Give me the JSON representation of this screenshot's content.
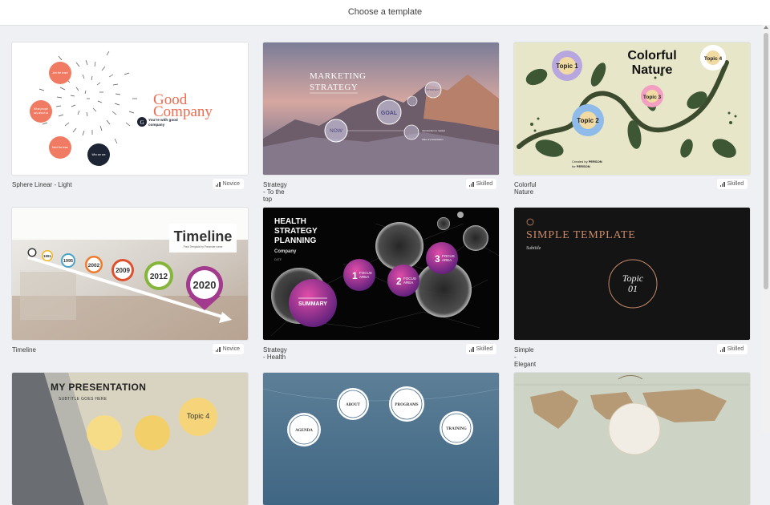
{
  "header": {
    "title": "Choose a template"
  },
  "templates": [
    {
      "name": "Sphere Linear - Light",
      "level": "Novice",
      "text": {
        "title1": "Good",
        "title2": "Company",
        "sub1": "You're with good",
        "sub2": "company",
        "logo": "G",
        "c1": "Join the team!",
        "c2a": "What people",
        "c2b": "say about us",
        "c3": "Meet the team",
        "c4": "Who we are"
      }
    },
    {
      "name": "Strategy - To the top",
      "level": "Skilled",
      "text": {
        "title1": "MARKETING",
        "title2": "STRATEGY",
        "goal": "GOAL",
        "now": "NOW",
        "strategy": "STRATEGY",
        "lbl1": "Introduction to market",
        "lbl2": "Sale of presentation"
      }
    },
    {
      "name": "Colorful Nature",
      "level": "Skilled",
      "text": {
        "title1": "Colorful",
        "title2": "Nature",
        "t1": "Topic 1",
        "t2": "Topic 2",
        "t3": "Topic 3",
        "t4": "Topic 4",
        "credit_prefix": "Created by ",
        "credit_bold": "PERSON",
        "credit2_prefix": "for ",
        "credit2_bold": "PERSON"
      }
    },
    {
      "name": "Timeline",
      "level": "Novice",
      "text": {
        "title": "Timeline",
        "sub": "Prezi Template by Presenter name",
        "years": [
          "1991",
          "1995",
          "2002",
          "2009",
          "2012",
          "2020"
        ]
      }
    },
    {
      "name": "Strategy - Health",
      "level": "Skilled",
      "text": {
        "title1": "HEALTH",
        "title2": "STRATEGY",
        "title3": "PLANNING",
        "company": "Company",
        "date": "DATE",
        "summary": "SUMMARY",
        "n1": "1",
        "n2": "2",
        "n3": "3",
        "focus": "FOCUS",
        "area": "AREA"
      }
    },
    {
      "name": "Simple - Elegant",
      "level": "Skilled",
      "text": {
        "title": "SIMPLE TEMPLATE",
        "sub": "Subtitle",
        "topic": "Topic",
        "num": "01"
      }
    },
    {
      "name": "",
      "level": "",
      "text": {
        "title": "MY PRESENTATION",
        "sub": "SUBTITLE GOES HERE",
        "topic": "Topic 4"
      }
    },
    {
      "name": "",
      "level": "",
      "text": {
        "about": "ABOUT",
        "programs": "PROGRAMS",
        "agenda": "AGENDA",
        "training": "TRAINING"
      }
    },
    {
      "name": "",
      "level": "",
      "text": {}
    }
  ]
}
